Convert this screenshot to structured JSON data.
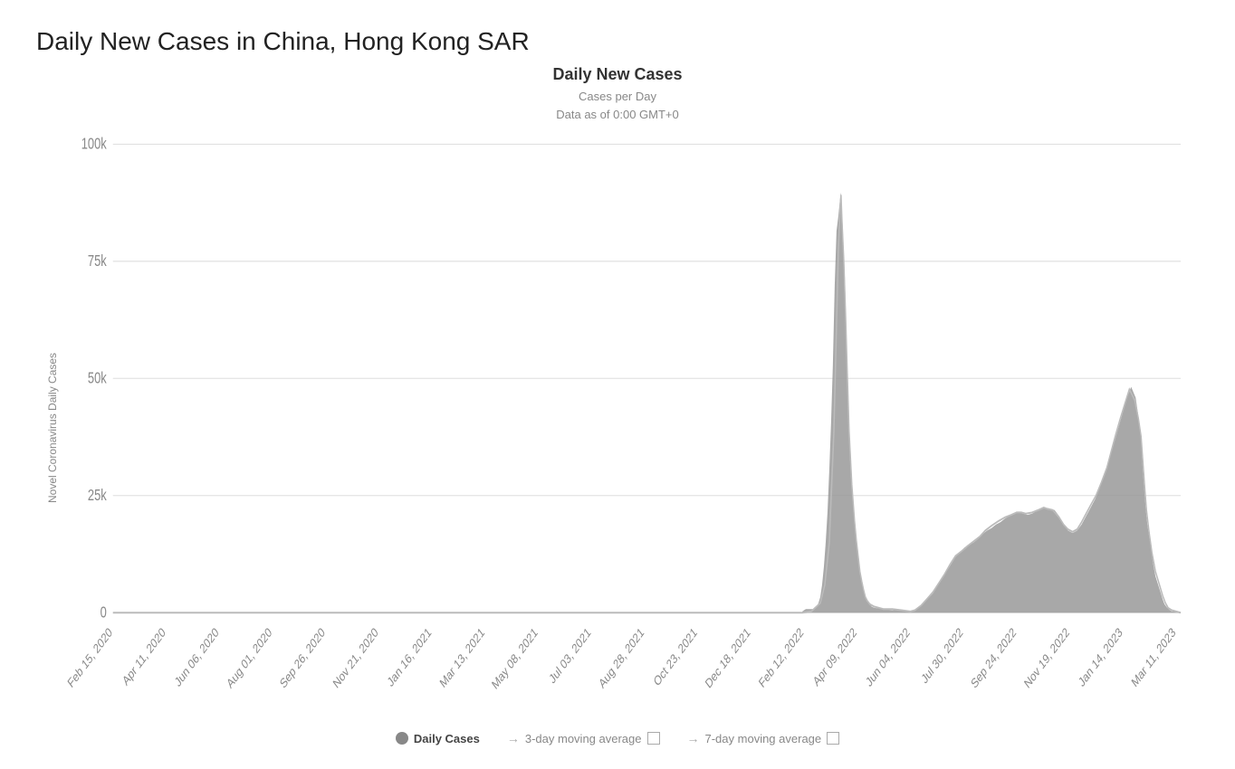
{
  "page": {
    "title": "Daily New Cases in China, Hong Kong SAR"
  },
  "chart": {
    "title": "Daily New Cases",
    "subtitle_line1": "Cases per Day",
    "subtitle_line2": "Data as of 0:00 GMT+0",
    "y_axis_label": "Novel Coronavirus Daily Cases",
    "y_ticks": [
      "100k",
      "75k",
      "50k",
      "25k",
      "0"
    ],
    "x_labels": [
      "Feb 15, 2020",
      "Apr 11, 2020",
      "Jun 06, 2020",
      "Aug 01, 2020",
      "Sep 26, 2020",
      "Nov 21, 2020",
      "Jan 16, 2021",
      "Mar 13, 2021",
      "May 08, 2021",
      "Jul 03, 2021",
      "Aug 28, 2021",
      "Oct 23, 2021",
      "Dec 18, 2021",
      "Feb 12, 2022",
      "Apr 09, 2022",
      "Jun 04, 2022",
      "Jul 30, 2022",
      "Sep 24, 2022",
      "Nov 19, 2022",
      "Jan 14, 2023",
      "Mar 11, 2023"
    ]
  },
  "legend": {
    "daily_cases_label": "Daily Cases",
    "moving_avg_3day_label": "3-day moving average",
    "moving_avg_7day_label": "7-day moving average"
  }
}
